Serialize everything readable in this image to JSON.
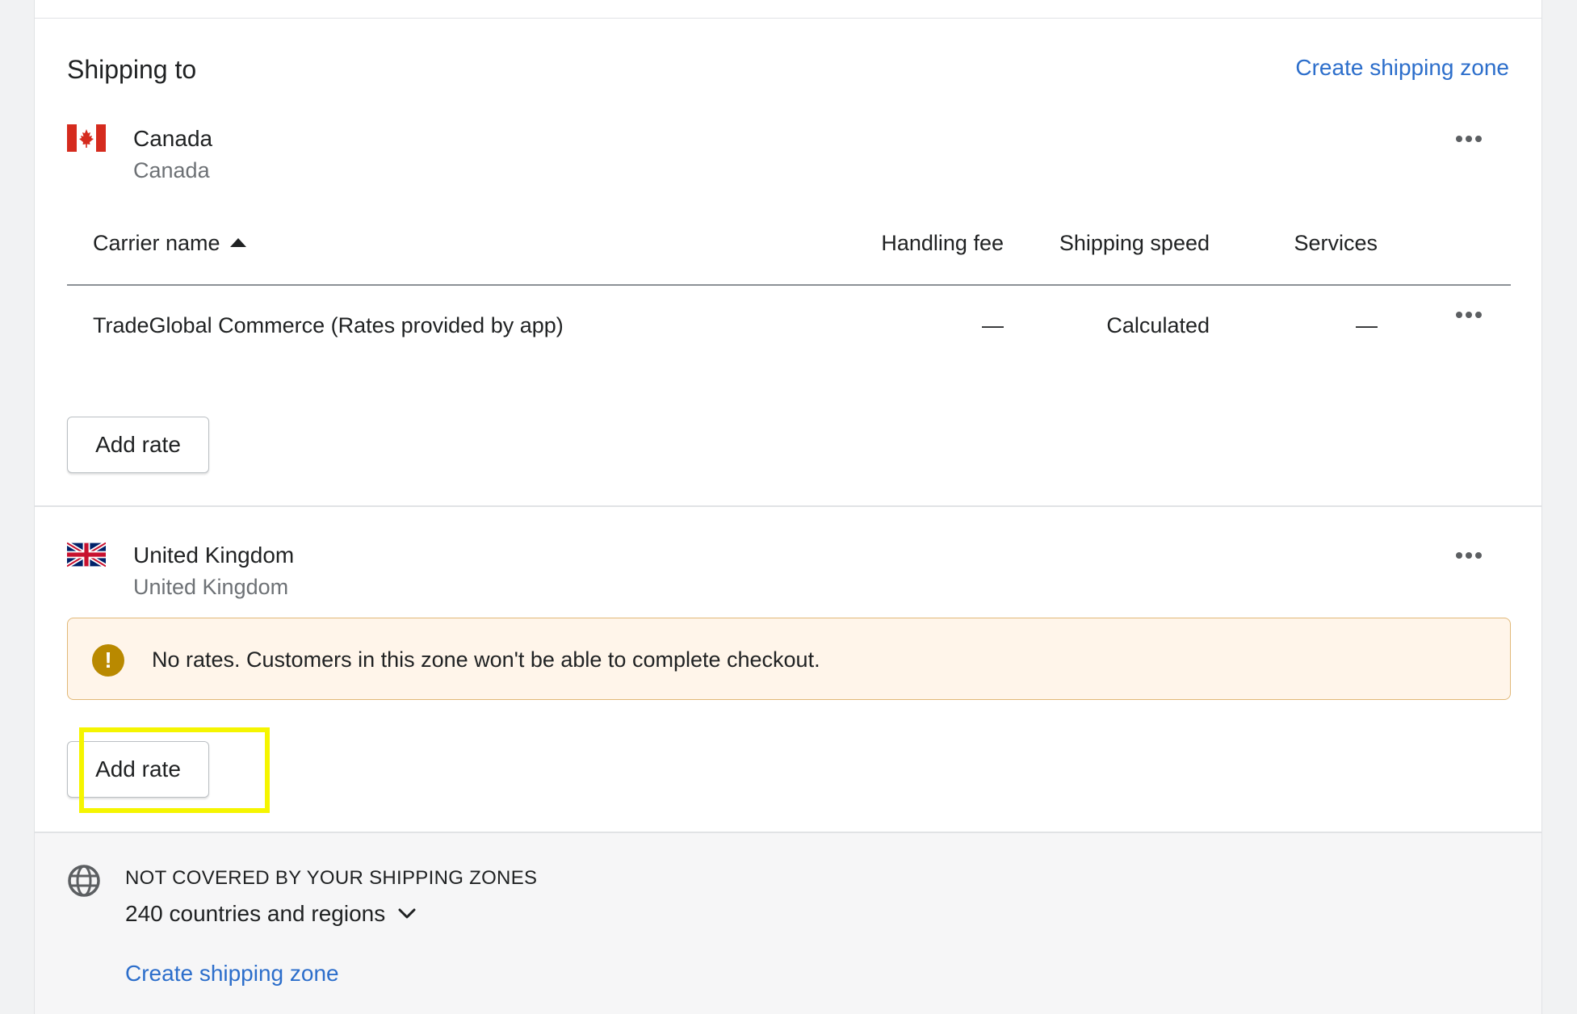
{
  "header": {
    "title": "Shipping to",
    "create_zone_link": "Create shipping zone"
  },
  "zones": [
    {
      "name": "Canada",
      "subtitle": "Canada",
      "flag": "canada-flag-icon",
      "table": {
        "columns": [
          "Carrier name",
          "Handling fee",
          "Shipping speed",
          "Services"
        ],
        "sort_column": "Carrier name",
        "sort_direction": "ascending",
        "rows": [
          {
            "carrier": "TradeGlobal Commerce (Rates provided by app)",
            "handling_fee": "—",
            "shipping_speed": "Calculated",
            "services": "—"
          }
        ]
      },
      "add_rate_label": "Add rate"
    },
    {
      "name": "United Kingdom",
      "subtitle": "United Kingdom",
      "flag": "uk-flag-icon",
      "warning": "No rates. Customers in this zone won't be able to complete checkout.",
      "add_rate_label": "Add rate"
    }
  ],
  "not_covered": {
    "title": "NOT COVERED BY YOUR SHIPPING ZONES",
    "count_text": "240 countries and regions",
    "create_zone_link": "Create shipping zone"
  },
  "colors": {
    "link": "#2c6ecb",
    "warning_bg": "#fff5ea",
    "warning_border": "#e1b878",
    "warning_icon": "#b98900",
    "highlight": "#f5f500"
  }
}
